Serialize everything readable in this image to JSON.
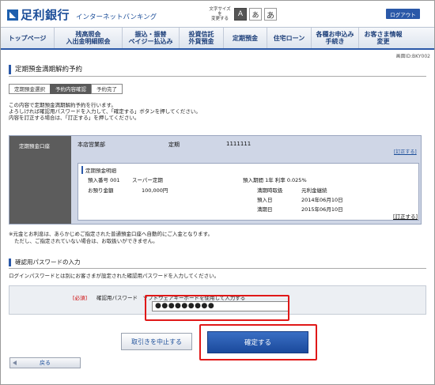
{
  "header": {
    "bank_name": "足利銀行",
    "service_name": "インターネットバンキング",
    "font_size_label_1": "文字サイズを",
    "font_size_label_2": "変更する",
    "font_sizes": [
      "A",
      "あ",
      "あ"
    ],
    "logout_label": "ログアウト"
  },
  "nav": {
    "items": [
      {
        "label1": "トップページ",
        "label2": ""
      },
      {
        "label1": "残高照会",
        "label2": "入出金明細照会"
      },
      {
        "label1": "振込・振替",
        "label2": "ペイジー払込み"
      },
      {
        "label1": "投資信託",
        "label2": "外貨預金"
      },
      {
        "label1": "定期預金",
        "label2": ""
      },
      {
        "label1": "住宅ローン",
        "label2": ""
      },
      {
        "label1": "各種お申込み",
        "label2": "手続き"
      },
      {
        "label1": "お客さま情報",
        "label2": "変更"
      }
    ]
  },
  "screen_id": "画面ID:BKY002",
  "page_title": "定期預金満期解約予約",
  "steps": [
    "定期預金選択",
    "予約内容確認",
    "予約完了"
  ],
  "intro": [
    "この内容で定期預金満期解約予約を行います。",
    "よろしければ確認用パスワードを入力して、「確定する」ボタンを押してください。",
    "内容を訂正する場合は、「訂正する」を押してください。"
  ],
  "account": {
    "label": "定期預金口座",
    "branch": "本店営業部",
    "type": "定期",
    "number": "1111111",
    "edit_link": "[訂正する]",
    "detail_title": "定期預金明細",
    "deposit_no": "預入番号 001",
    "product": "スーパー定期",
    "term_rate": "預入期間 1年 利率 0.025%",
    "amount_label": "お預り金額",
    "amount": "100,000円",
    "maturity_method_label": "満期時取扱",
    "maturity_method": "元利金継続",
    "deposit_date_label": "預入日",
    "deposit_date": "2014年06月10日",
    "maturity_date_label": "満期日",
    "maturity_date": "2015年06月10日",
    "detail_edit_link": "[訂正する]"
  },
  "notes": [
    "※元金とお利息は、あらかじめご指定された普通預金口座へ自動的にご入金となります。",
    "ただし、ご指定されていない場合は、お取扱いができません。"
  ],
  "password_section": {
    "title": "確認用パスワードの入力",
    "description": "ログインパスワードとは別にお客さまが設定された確認用パスワードを入力してください。",
    "required": "[必須]",
    "label": "確認用パスワード　ソフトウェアキーボードを使用して入力する",
    "value": "●●●●●●●●●"
  },
  "buttons": {
    "cancel": "取引きを中止する",
    "confirm": "確定する",
    "back": "戻る"
  }
}
